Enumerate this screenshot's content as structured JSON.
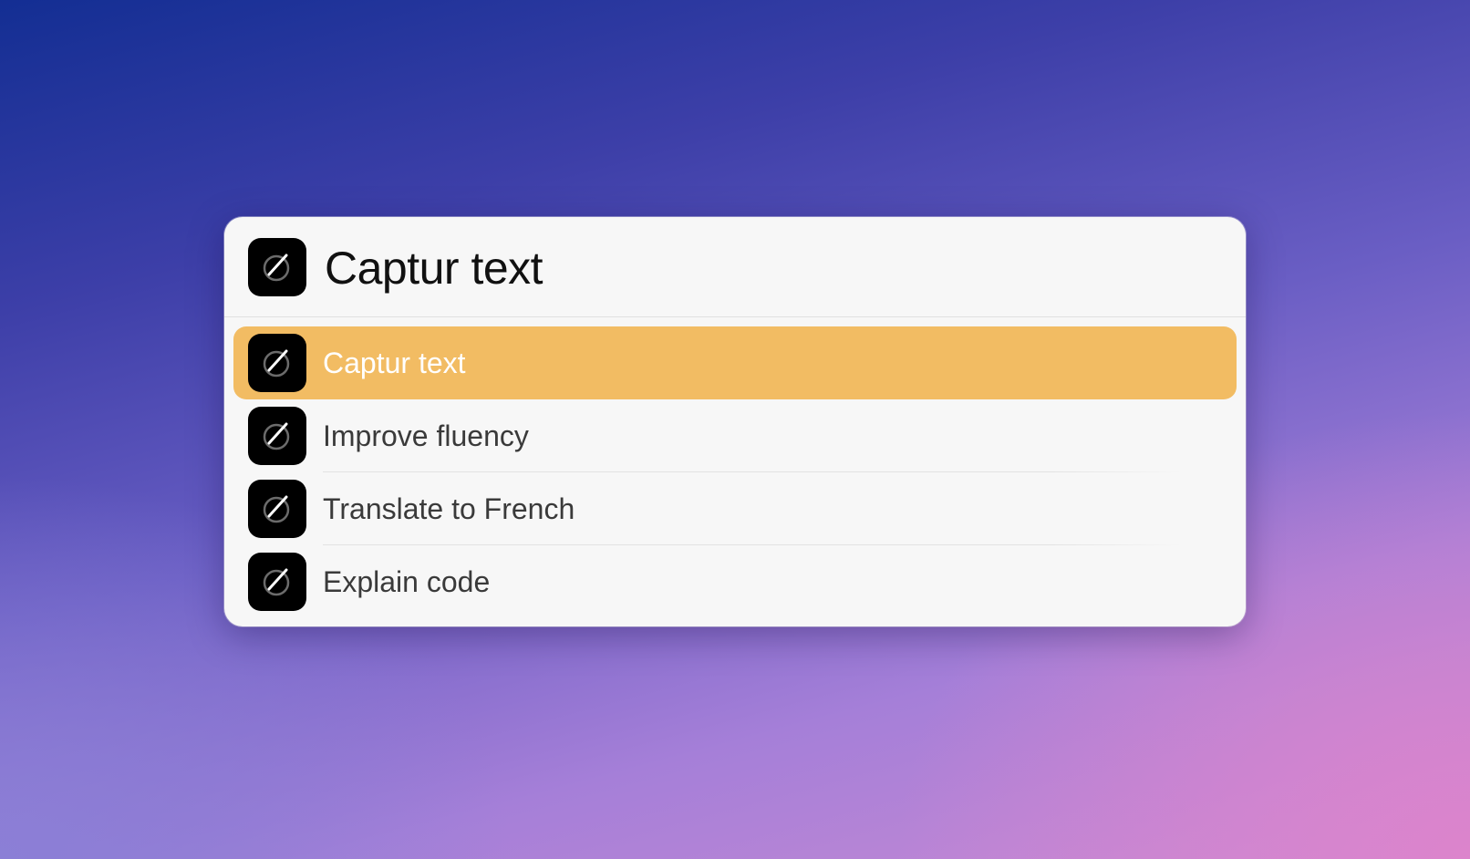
{
  "header": {
    "title": "Captur text",
    "icon": "captur-app-icon"
  },
  "items": [
    {
      "label": "Captur text",
      "icon": "captur-app-icon",
      "selected": true
    },
    {
      "label": "Improve fluency",
      "icon": "captur-app-icon",
      "selected": false
    },
    {
      "label": "Translate to French",
      "icon": "captur-app-icon",
      "selected": false
    },
    {
      "label": "Explain code",
      "icon": "captur-app-icon",
      "selected": false
    }
  ],
  "colors": {
    "selection": "#f2bc63",
    "panel": "#f7f7f7",
    "icon_background": "#000000",
    "selected_text": "#ffffff",
    "item_text": "#3a3a3a"
  }
}
